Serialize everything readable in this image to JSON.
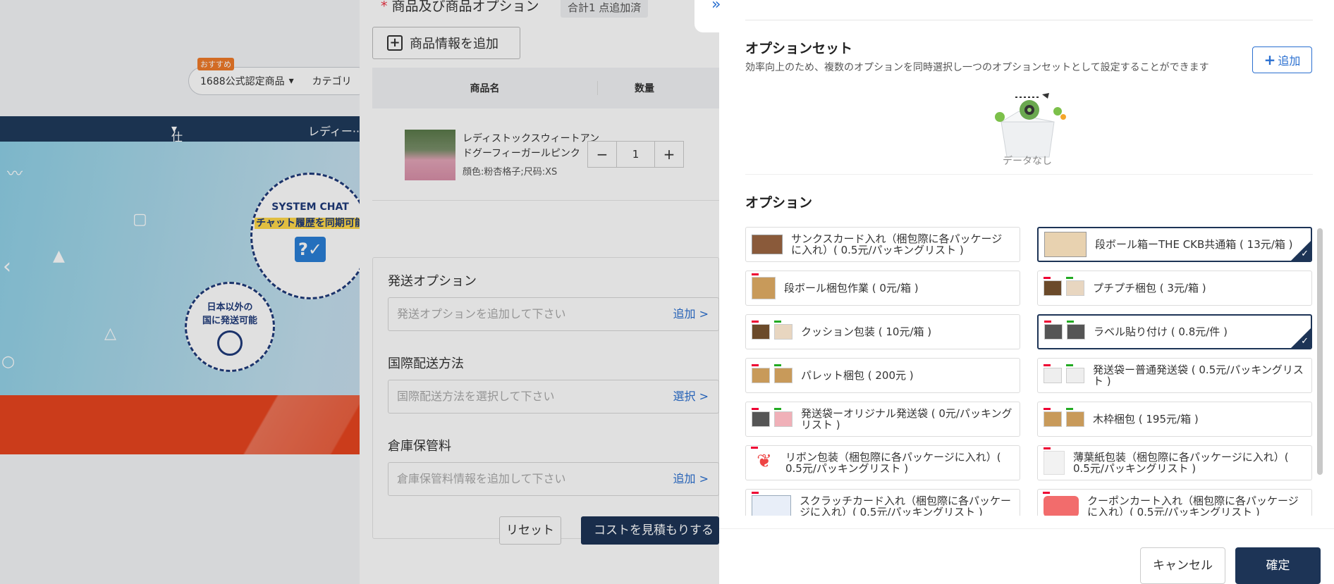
{
  "background": {
    "badge": "おすすめ",
    "search_item1": "1688公式認定商品",
    "search_item2": "カテゴリ",
    "nav_item1": "仕入れ元",
    "nav_item2": "レディー··",
    "banner_chat_title": "SYSTEM CHAT",
    "banner_chat_sub": "チャット履歴を同期可能",
    "banner_ship_line1": "日本以外の",
    "banner_ship_line2": "国に発送可能"
  },
  "middle": {
    "title": "商品及び商品オプション",
    "count": "合計1 点追加済",
    "add_button": "商品情報を追加",
    "col_name": "商品名",
    "col_qty": "数量",
    "product_name": "レディストックスウィートアンドグーフィーガールピンク",
    "product_attr": "顔色:粉杏格子;尺码:XS",
    "qty": "1",
    "ship_label": "発送オプション",
    "ship_placeholder": "発送オプションを追加して下さい",
    "ship_link": "追加 >",
    "intl_label": "国際配送方法",
    "intl_placeholder": "国際配送方法を選択して下さい",
    "intl_link": "選択 >",
    "storage_label": "倉庫保管料",
    "storage_placeholder": "倉庫保管料情報を追加して下さい",
    "storage_link": "追加 >",
    "reset": "リセット",
    "estimate": "コストを見積もりする"
  },
  "drawer": {
    "set_title": "オプションセット",
    "set_desc": "効率向上のため、複数のオプションを同時選択し一つのオプションセットとして設定することができます",
    "add": "追加",
    "empty": "データなし",
    "options_title": "オプション",
    "options": [
      {
        "text": "サンクスカード入れ（梱包際に各パッケージに入れ）( 0.5元/パッキングリスト )",
        "selected": false
      },
      {
        "text": "段ボール箱ーTHE CKB共通箱 ( 13元/箱 )",
        "selected": true
      },
      {
        "text": "段ボール梱包作業 ( 0元/箱 )",
        "selected": false
      },
      {
        "text": "プチプチ梱包 ( 3元/箱 )",
        "selected": false
      },
      {
        "text": "クッション包装 ( 10元/箱 )",
        "selected": false
      },
      {
        "text": "ラベル貼り付け ( 0.8元/件 )",
        "selected": true
      },
      {
        "text": "パレット梱包 ( 200元 )",
        "selected": false
      },
      {
        "text": "発送袋ー普通発送袋 ( 0.5元/パッキングリスト )",
        "selected": false
      },
      {
        "text": "発送袋ーオリジナル発送袋 ( 0元/パッキングリスト )",
        "selected": false
      },
      {
        "text": "木枠梱包 ( 195元/箱 )",
        "selected": false
      },
      {
        "text": "リボン包装（梱包際に各パッケージに入れ）( 0.5元/パッキングリスト )",
        "selected": false
      },
      {
        "text": "薄葉紙包装（梱包際に各パッケージに入れ）( 0.5元/パッキングリスト )",
        "selected": false
      },
      {
        "text": "スクラッチカード入れ（梱包際に各パッケージに入れ）( 0.5元/パッキングリスト )",
        "selected": false
      },
      {
        "text": "クーポンカート入れ（梱包際に各パッケージに入れ）( 0.5元/パッキングリスト )",
        "selected": false
      }
    ],
    "cancel": "キャンセル",
    "confirm": "確定"
  }
}
